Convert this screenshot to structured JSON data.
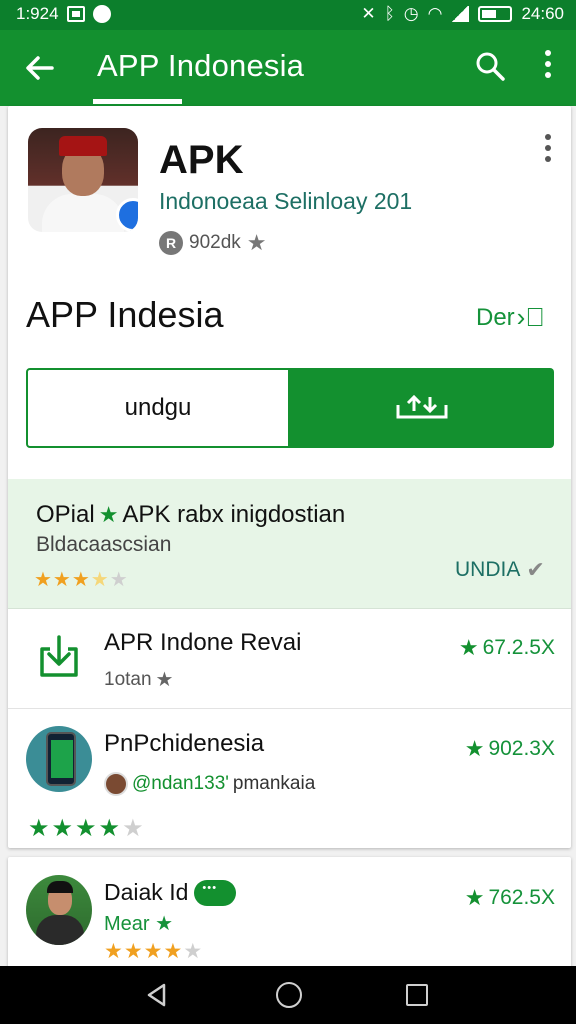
{
  "status_bar": {
    "time": "1:924",
    "clock": "24:60"
  },
  "app_bar": {
    "title": "APP Indonesia"
  },
  "app": {
    "name": "APK",
    "subtitle": "Indonoeaa Selinloay 201",
    "rating_text": "902dk"
  },
  "section": {
    "title": "APP Indesia",
    "detail_label": "Der"
  },
  "download": {
    "label": "undgu"
  },
  "highlight": {
    "title_prefix": "OPial",
    "title_rest": "APK rabx inigdostian",
    "subtitle": "Bldacaascsian",
    "badge": "UNDIA",
    "stars": "★★★★★"
  },
  "list": [
    {
      "title": "APR Indone Revai",
      "sub": "1otan",
      "count": "67.2.5X"
    },
    {
      "title": "PnPchidenesia",
      "handle": "@ndan133'",
      "sub_rest": "pmankaia",
      "count": "902.3X"
    }
  ],
  "card2": {
    "title": "Daiak Id",
    "sub": "Mear",
    "count": "762.5X"
  },
  "colors": {
    "primary": "#13902f",
    "status_bar": "#0c7f2c",
    "highlight_bg": "#e7f5e7",
    "star": "#f0a020"
  }
}
